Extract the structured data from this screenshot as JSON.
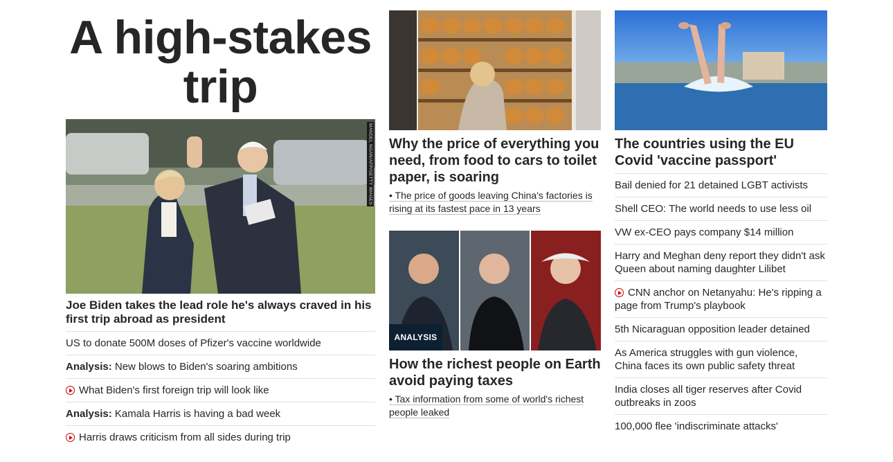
{
  "column1": {
    "banner": "A high-stakes trip",
    "photo": {
      "credit": "MANDEL NGAN/AFP/GETTY IMAGES"
    },
    "lead": "Joe Biden takes the lead role he's always craved in his first trip abroad as president",
    "stories": [
      {
        "kicker": "",
        "text": "US to donate 500M doses of Pfizer's vaccine worldwide",
        "video": false
      },
      {
        "kicker": "Analysis:",
        "text": "New blows to Biden's soaring ambitions",
        "video": false
      },
      {
        "kicker": "",
        "text": "What Biden's first foreign trip will look like",
        "video": true
      },
      {
        "kicker": "Analysis:",
        "text": "Kamala Harris is having a bad week",
        "video": false
      },
      {
        "kicker": "",
        "text": "Harris draws criticism from all sides during trip",
        "video": true
      }
    ]
  },
  "column2": {
    "card1": {
      "headline": "Why the price of everything you need, from food to cars to toilet paper, is soaring",
      "sub": "• The price of goods leaving China's factories is rising at its fastest pace in 13 years"
    },
    "card2": {
      "tag": "ANALYSIS",
      "headline": "How the richest people on Earth avoid paying taxes",
      "sub": "• Tax information from some of world's richest people leaked"
    }
  },
  "column3": {
    "card": {
      "headline": "The countries using the EU Covid 'vaccine passport'"
    },
    "stories": [
      {
        "text": "Bail denied for 21 detained LGBT activists",
        "video": false
      },
      {
        "text": "Shell CEO: The world needs to use less oil",
        "video": false
      },
      {
        "text": "VW ex-CEO pays company $14 million",
        "video": false
      },
      {
        "text": "Harry and Meghan deny report they didn't ask Queen about naming daughter Lilibet",
        "video": false
      },
      {
        "text": "CNN anchor on Netanyahu: He's ripping a page from Trump's playbook",
        "video": true
      },
      {
        "text": "5th Nicaraguan opposition leader detained",
        "video": false
      },
      {
        "text": "As America struggles with gun violence, China faces its own public safety threat",
        "video": false
      },
      {
        "text": "India closes all tiger reserves after Covid outbreaks in zoos",
        "video": false
      },
      {
        "text": "100,000 flee 'indiscriminate attacks'",
        "video": false
      }
    ]
  },
  "colors": {
    "text": "#262626",
    "video_red": "#cc0000",
    "divider": "#e0e0e0",
    "tag_bg": "#0c2031"
  }
}
